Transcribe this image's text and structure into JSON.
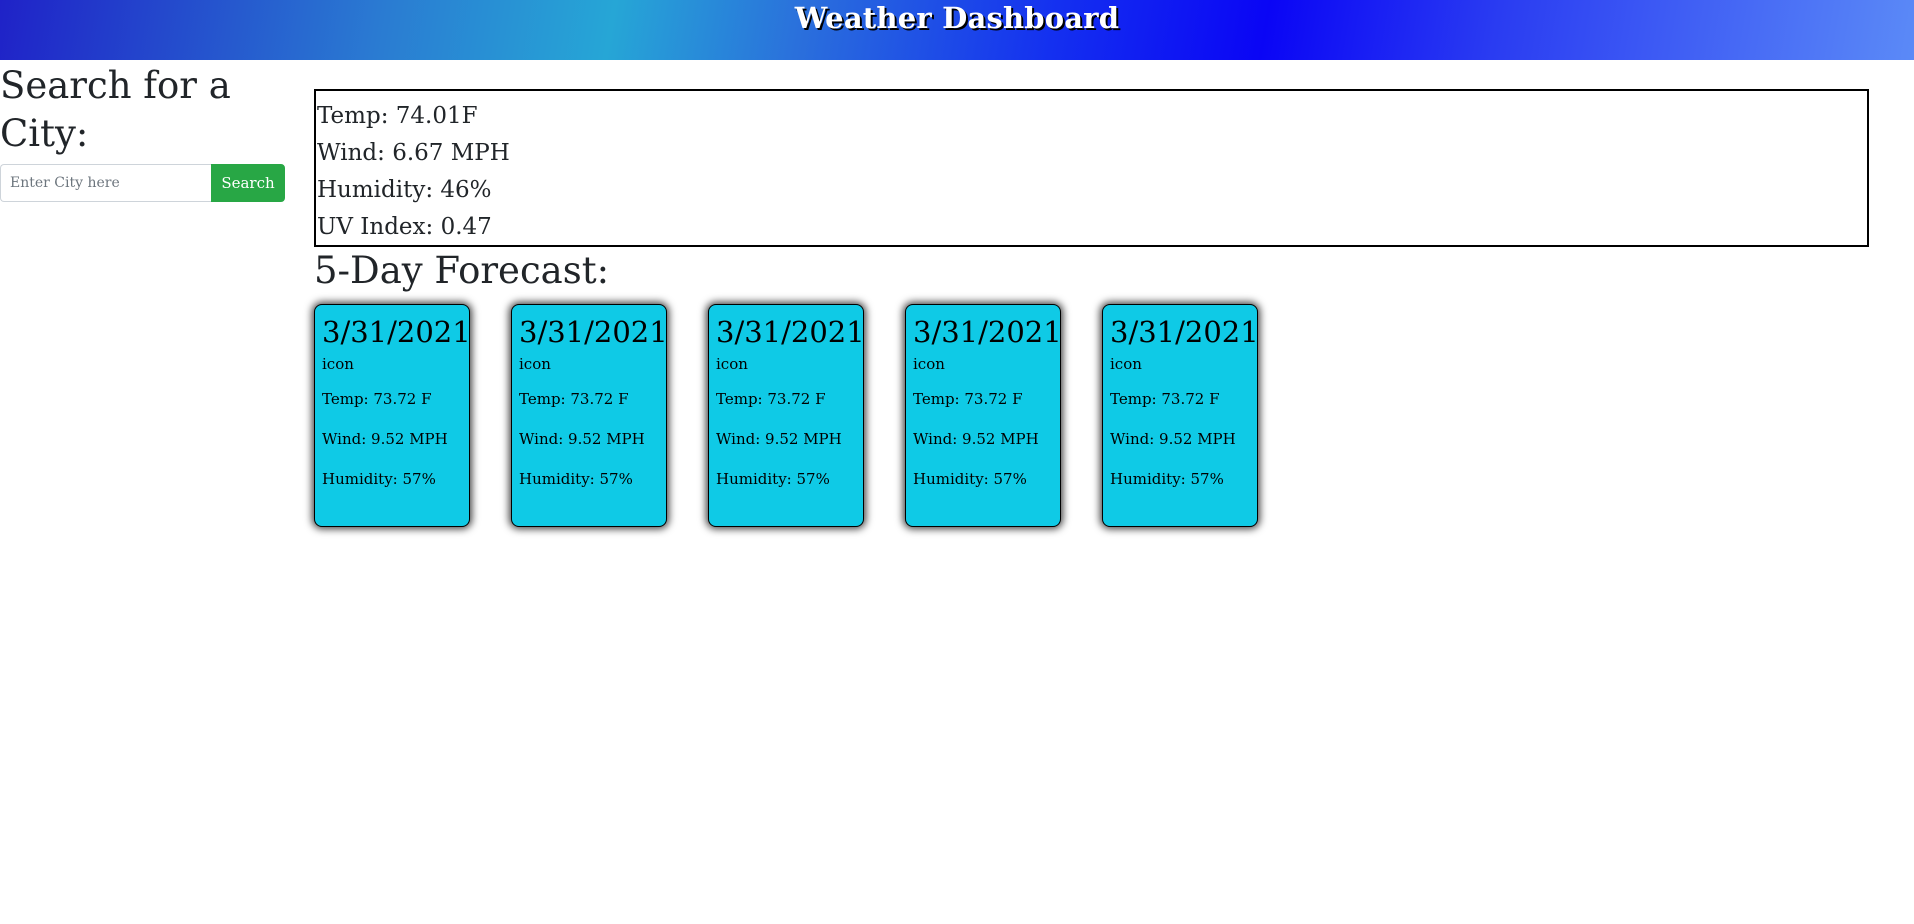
{
  "header": {
    "title": "Weather Dashboard"
  },
  "sidebar": {
    "heading": "Search for a City:",
    "search": {
      "placeholder": "Enter City here",
      "value": "",
      "button_label": "Search"
    }
  },
  "current": {
    "temp": "Temp: 74.01F",
    "wind": "Wind: 6.67 MPH",
    "humidity": "Humidity: 46%",
    "uv": "UV Index: 0.47"
  },
  "forecast": {
    "heading": "5-Day Forecast:",
    "cards": [
      {
        "date": "3/31/2021",
        "icon": "icon",
        "temp": "Temp: 73.72 F",
        "wind": "Wind: 9.52 MPH",
        "humidity": "Humidity: 57%"
      },
      {
        "date": "3/31/2021",
        "icon": "icon",
        "temp": "Temp: 73.72 F",
        "wind": "Wind: 9.52 MPH",
        "humidity": "Humidity: 57%"
      },
      {
        "date": "3/31/2021",
        "icon": "icon",
        "temp": "Temp: 73.72 F",
        "wind": "Wind: 9.52 MPH",
        "humidity": "Humidity: 57%"
      },
      {
        "date": "3/31/2021",
        "icon": "icon",
        "temp": "Temp: 73.72 F",
        "wind": "Wind: 9.52 MPH",
        "humidity": "Humidity: 57%"
      },
      {
        "date": "3/31/2021",
        "icon": "icon",
        "temp": "Temp: 73.72 F",
        "wind": "Wind: 9.52 MPH",
        "humidity": "Humidity: 57%"
      }
    ]
  },
  "colors": {
    "card_background": "#0fcae6",
    "search_button": "#28a745",
    "header_gradient_main": "#0a05f5"
  }
}
